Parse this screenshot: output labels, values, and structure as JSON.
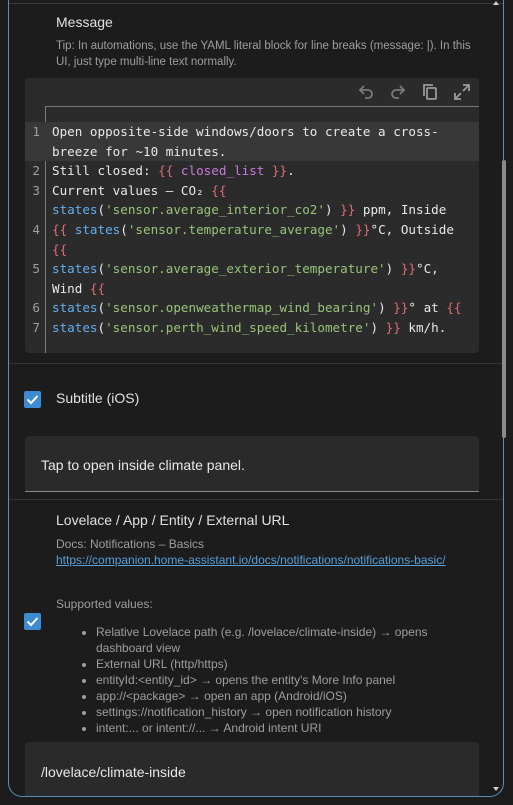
{
  "message": {
    "label": "Message",
    "tip": "Tip: In automations, use the YAML literal block for line breaks (message: |). In this UI, just type multi-line text normally."
  },
  "editor": {
    "toolbar": [
      {
        "name": "undo-icon",
        "glyph": "↶"
      },
      {
        "name": "redo-icon",
        "glyph": "↷"
      },
      {
        "name": "copy-icon",
        "glyph": "⧉"
      },
      {
        "name": "fullscreen-icon",
        "glyph": "⤢"
      }
    ],
    "lines": [
      {
        "num": "1",
        "segs": [
          [
            "t",
            "Open opposite-side windows/doors to create a cross-"
          ]
        ]
      },
      {
        "num": "",
        "segs": [
          [
            "t",
            "breeze for ~10 minutes."
          ]
        ]
      },
      {
        "num": "2",
        "segs": [
          [
            "t",
            "Still closed: "
          ],
          [
            "p",
            "{{ "
          ],
          [
            "v",
            "closed_list"
          ],
          [
            "p",
            " }}"
          ],
          [
            "t",
            "."
          ]
        ]
      },
      {
        "num": "3",
        "segs": [
          [
            "t",
            "Current values — CO₂ "
          ],
          [
            "p",
            "{{"
          ]
        ]
      },
      {
        "num": "",
        "segs": [
          [
            "f",
            "states"
          ],
          [
            "t",
            "("
          ],
          [
            "s",
            "'sensor.average_interior_co2'"
          ],
          [
            "t",
            ") "
          ],
          [
            "p",
            "}}"
          ],
          [
            "t",
            " ppm, Inside"
          ]
        ]
      },
      {
        "num": "4",
        "segs": [
          [
            "p",
            "{{ "
          ],
          [
            "f",
            "states"
          ],
          [
            "t",
            "("
          ],
          [
            "s",
            "'sensor.temperature_average'"
          ],
          [
            "t",
            ") "
          ],
          [
            "p",
            "}}"
          ],
          [
            "t",
            "°C, Outside"
          ]
        ]
      },
      {
        "num": "",
        "segs": [
          [
            "p",
            "{{"
          ]
        ]
      },
      {
        "num": "5",
        "segs": [
          [
            "f",
            "states"
          ],
          [
            "t",
            "("
          ],
          [
            "s",
            "'sensor.average_exterior_temperature'"
          ],
          [
            "t",
            ") "
          ],
          [
            "p",
            "}}"
          ],
          [
            "t",
            "°C,"
          ]
        ]
      },
      {
        "num": "",
        "segs": [
          [
            "t",
            "Wind "
          ],
          [
            "p",
            "{{"
          ]
        ]
      },
      {
        "num": "6",
        "segs": [
          [
            "f",
            "states"
          ],
          [
            "t",
            "("
          ],
          [
            "s",
            "'sensor.openweathermap_wind_bearing'"
          ],
          [
            "t",
            ") "
          ],
          [
            "p",
            "}}"
          ],
          [
            "t",
            "° at "
          ],
          [
            "p",
            "{{"
          ]
        ]
      },
      {
        "num": "7",
        "segs": [
          [
            "f",
            "states"
          ],
          [
            "t",
            "("
          ],
          [
            "s",
            "'sensor.perth_wind_speed_kilometre'"
          ],
          [
            "t",
            ") "
          ],
          [
            "p",
            "}}"
          ],
          [
            "t",
            " km/h."
          ]
        ]
      }
    ]
  },
  "subtitle": {
    "label": "Subtitle (iOS)",
    "checked": true,
    "value": "Tap to open inside climate panel."
  },
  "url": {
    "label": "Lovelace / App / Entity / External URL",
    "checked": true,
    "docs_prefix": "Docs: Notifications – Basics",
    "docs_link": "https://companion.home-assistant.io/docs/notifications/notifications-basic/",
    "supported_label": "Supported values:",
    "values": [
      "Relative Lovelace path (e.g. /lovelace/climate-inside) → opens dashboard view",
      "External URL (http/https)",
      "entityId:<entity_id> → opens the entity's More Info panel",
      "app://<package> → open an app (Android/iOS)",
      "settings://notification_history → open notification history",
      "intent:... or intent://... → Android intent URI"
    ],
    "value": "/lovelace/climate-inside"
  },
  "colors": {
    "accent": "#3d8bd0",
    "border": "#5b8fb5",
    "link": "#5a9fd6"
  }
}
